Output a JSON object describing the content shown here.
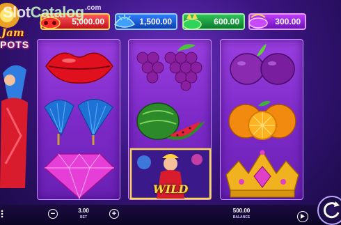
{
  "watermark": {
    "slot": "Slot",
    "catalog": "Catalog",
    "com": ".com"
  },
  "game_title": {
    "line1": "Jam",
    "line2": "POTS"
  },
  "jackpots": [
    {
      "value": "5,000.00",
      "color": "#d4151f"
    },
    {
      "value": "1,500.00",
      "color": "#1a55d6"
    },
    {
      "value": "600.00",
      "color": "#1b9a3c"
    },
    {
      "value": "300.00",
      "color": "#8a22d0"
    }
  ],
  "reels": [
    [
      "lips",
      "blue-fans",
      "pink-diamond"
    ],
    [
      "grapes",
      "watermelon",
      "wild-character"
    ],
    [
      "plums",
      "oranges",
      "golden-crown"
    ]
  ],
  "wild_label": "WILD",
  "controls": {
    "minus": "−",
    "plus": "+",
    "bet_value": "3.00",
    "bet_label": "BET",
    "balance_value": "500.00",
    "balance_label": "BALANCE"
  },
  "colors": {
    "reel_bg": "#8a34d4",
    "accent_gold": "#ffd84a"
  }
}
